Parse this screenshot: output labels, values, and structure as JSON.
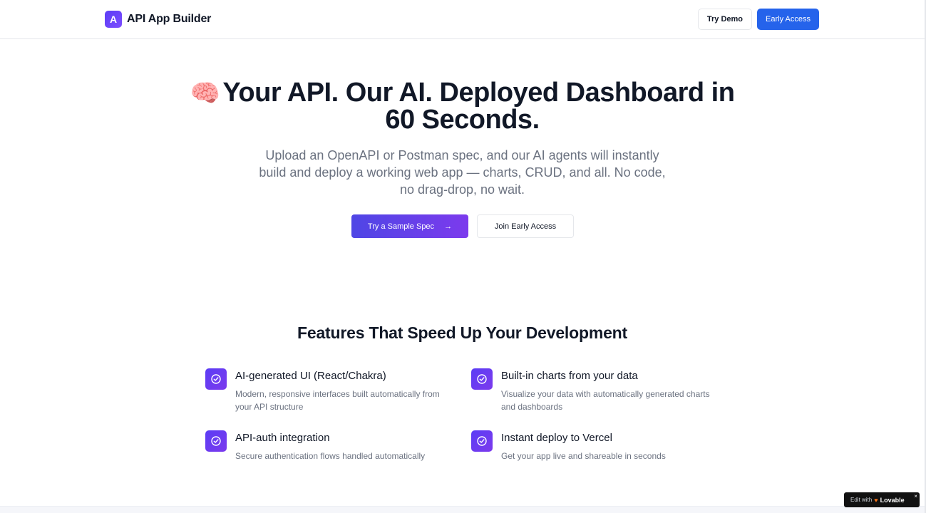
{
  "header": {
    "logo_letter": "A",
    "brand": "API App Builder",
    "try_demo": "Try Demo",
    "early_access": "Early Access"
  },
  "hero": {
    "emoji": "🧠",
    "title_line1": "Your API. Our AI. Deployed Dashboard in",
    "title_line2": "60 Seconds.",
    "subtitle": "Upload an OpenAPI or Postman spec, and our AI agents will instantly build and deploy a working web app — charts, CRUD, and all. No code, no drag-drop, no wait.",
    "primary_cta": "Try a Sample Spec",
    "primary_cta_arrow": "→",
    "secondary_cta": "Join Early Access"
  },
  "features": {
    "heading": "Features That Speed Up Your Development",
    "items": [
      {
        "title": "AI-generated UI (React/Chakra)",
        "desc": "Modern, responsive interfaces built automatically from your API structure",
        "icon": "check-circle-icon"
      },
      {
        "title": "Built-in charts from your data",
        "desc": "Visualize your data with automatically generated charts and dashboards",
        "icon": "check-circle-icon"
      },
      {
        "title": "API-auth integration",
        "desc": "Secure authentication flows handled automatically",
        "icon": "check-circle-icon"
      },
      {
        "title": "Instant deploy to Vercel",
        "desc": "Get your app live and shareable in seconds",
        "icon": "check-circle-icon"
      }
    ]
  },
  "badge": {
    "edit_with": "Edit with",
    "brand": "Lovable",
    "close": "×"
  },
  "colors": {
    "accent": "#2563eb",
    "brand_purple": "#6d3df0",
    "text_muted": "#6b7280"
  }
}
